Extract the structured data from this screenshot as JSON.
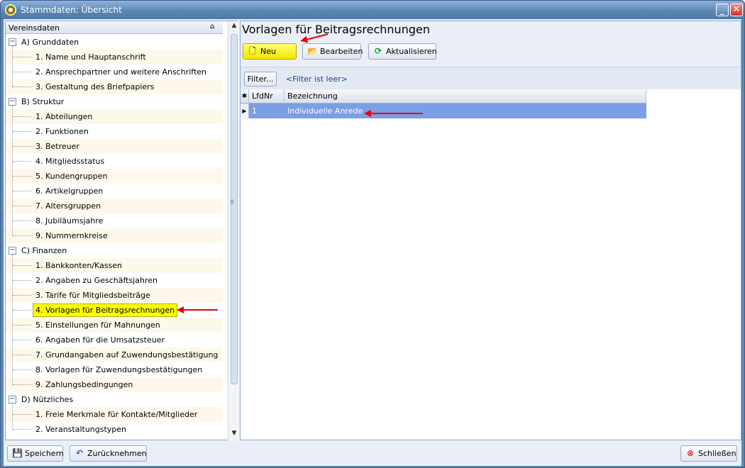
{
  "window": {
    "title": "Stammdaten: Übersicht",
    "minimize": "_",
    "close": "✕"
  },
  "tree": {
    "header": "Vereinsdaten",
    "groups": [
      {
        "label": "A) Grunddaten",
        "items": [
          "1. Name und Hauptanschrift",
          "2. Ansprechpartner und weitere Anschriften",
          "3. Gestaltung des Briefpapiers"
        ]
      },
      {
        "label": "B) Struktur",
        "items": [
          "1. Abteilungen",
          "2. Funktionen",
          "3. Betreuer",
          "4. Mitgliedsstatus",
          "5. Kundengruppen",
          "6. Artikelgruppen",
          "7. Altersgruppen",
          "8. Jubiläumsjahre",
          "9. Nummernkreise"
        ]
      },
      {
        "label": "C) Finanzen",
        "items": [
          "1. Bankkonten/Kassen",
          "2. Angaben zu Geschäftsjahren",
          "3. Tarife für Mitgliedsbeiträge",
          "4. Vorlagen für Beitragsrechnungen",
          "5. Einstellungen für Mahnungen",
          "6. Angaben für die Umsatzsteuer",
          "7. Grundangaben auf Zuwendungsbestätigung",
          "8. Vorlagen für Zuwendungsbestätigungen",
          "9. Zahlungsbedingungen"
        ]
      },
      {
        "label": "D) Nützliches",
        "items": [
          "1. Freie Merkmale für Kontakte/Mitglieder",
          "2. Veranstaltungstypen"
        ]
      }
    ],
    "selected": "4. Vorlagen für Beitragsrechnungen"
  },
  "main": {
    "title": "Vorlagen für Beitragsrechnungen",
    "toolbar": {
      "new": "Neu",
      "edit": "Bearbeiten",
      "refresh": "Aktualisieren"
    },
    "filter": {
      "button": "Filter...",
      "text": "<Filter ist leer>"
    },
    "grid": {
      "columns": [
        "LfdNr",
        "Bezeichnung"
      ],
      "rows": [
        {
          "lfdnr": "1",
          "bezeichnung": "Individuelle Anrede"
        }
      ]
    }
  },
  "bottom": {
    "save": "Speichern",
    "undo": "Zurücknehmen",
    "close": "Schließen"
  },
  "colors": {
    "accent_yellow": "#ffff00",
    "selection_blue": "#7b9ee5",
    "annotation_red": "#e00000"
  }
}
